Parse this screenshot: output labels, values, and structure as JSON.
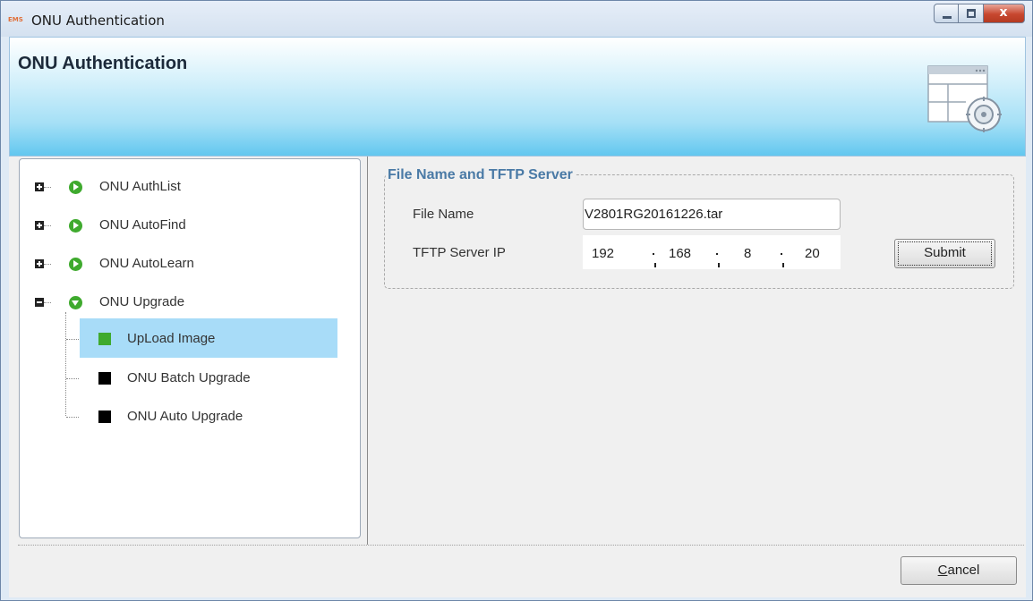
{
  "window": {
    "app_icon_text": "EMS",
    "title": "ONU Authentication",
    "controls": {
      "minimize": "minimize",
      "maximize": "maximize",
      "close": "x"
    }
  },
  "banner": {
    "title": "ONU Authentication",
    "icon": "window-settings-icon"
  },
  "tree": {
    "items": [
      {
        "label": "ONU AuthList",
        "expander": "plus",
        "icon": "play-circle-icon"
      },
      {
        "label": "ONU AutoFind",
        "expander": "plus",
        "icon": "play-circle-icon"
      },
      {
        "label": "ONU AutoLearn",
        "expander": "plus",
        "icon": "play-circle-icon"
      },
      {
        "label": "ONU Upgrade",
        "expander": "minus",
        "icon": "down-circle-icon",
        "children": [
          {
            "label": "UpLoad Image",
            "selected": true,
            "square_color": "#3faa2e"
          },
          {
            "label": "ONU Batch Upgrade",
            "selected": false,
            "square_color": "#000000"
          },
          {
            "label": "ONU Auto Upgrade",
            "selected": false,
            "square_color": "#000000"
          }
        ]
      }
    ]
  },
  "form": {
    "group_title": "File Name and TFTP Server",
    "file_name_label": "File Name",
    "file_name_value": "V2801RG20161226.tar",
    "tftp_label": "TFTP Server IP",
    "ip": [
      "192",
      "168",
      "8",
      "20"
    ],
    "submit_label": "Submit"
  },
  "footer": {
    "cancel_mnemonic": "C",
    "cancel_rest": "ancel"
  },
  "colors": {
    "accent_legend": "#4a7aa6",
    "selection": "#a8dcf8",
    "tree_green": "#3faa2e",
    "close_red": "#c7472f"
  }
}
